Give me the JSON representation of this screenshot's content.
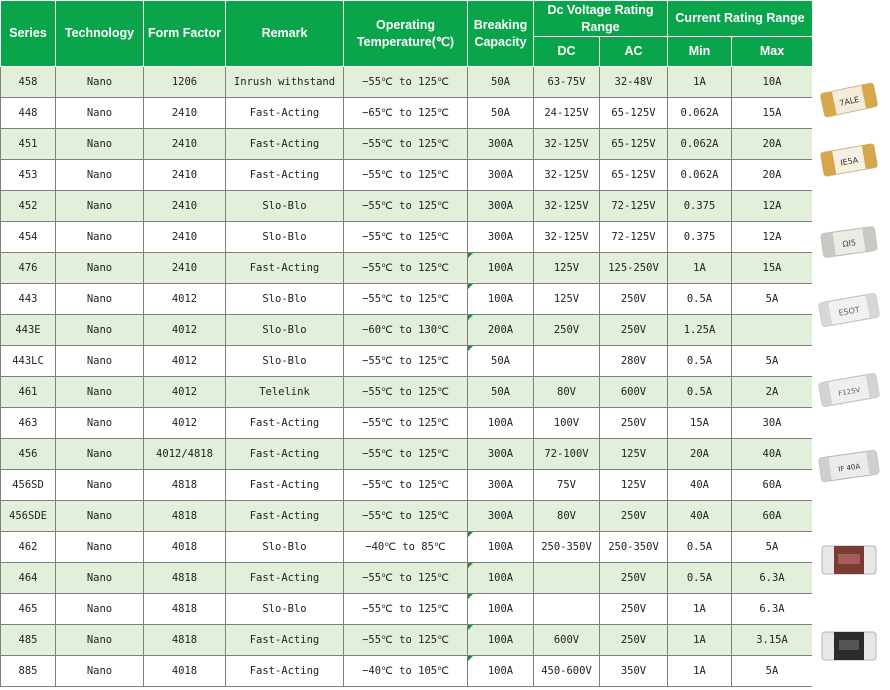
{
  "headers": {
    "series": "Series",
    "technology": "Technology",
    "form_factor": "Form Factor",
    "remark": "Remark",
    "operating_temp": "Operating Temperature(℃)",
    "breaking_capacity": "Breaking Capacity",
    "dc_voltage_range": "Dc Voltage Rating Range",
    "current_range": "Current Rating Range",
    "dc": "DC",
    "ac": "AC",
    "min": "Min",
    "max": "Max"
  },
  "rows": [
    {
      "series": "458",
      "technology": "Nano",
      "form_factor": "1206",
      "remark": "Inrush withstand",
      "temp": "−55℃ to 125℃",
      "breaking": "50A",
      "dc": "63-75V",
      "ac": "32-48V",
      "min": "1A",
      "max": "10A"
    },
    {
      "series": "448",
      "technology": "Nano",
      "form_factor": "2410",
      "remark": "Fast-Acting",
      "temp": "−65℃ to 125℃",
      "breaking": "50A",
      "dc": "24-125V",
      "ac": "65-125V",
      "min": "0.062A",
      "max": "15A"
    },
    {
      "series": "451",
      "technology": "Nano",
      "form_factor": "2410",
      "remark": "Fast-Acting",
      "temp": "−55℃ to 125℃",
      "breaking": "300A",
      "dc": "32-125V",
      "ac": "65-125V",
      "min": "0.062A",
      "max": "20A"
    },
    {
      "series": "453",
      "technology": "Nano",
      "form_factor": "2410",
      "remark": "Fast-Acting",
      "temp": "−55℃ to 125℃",
      "breaking": "300A",
      "dc": "32-125V",
      "ac": "65-125V",
      "min": "0.062A",
      "max": "20A"
    },
    {
      "series": "452",
      "technology": "Nano",
      "form_factor": "2410",
      "remark": "Slo-Blo",
      "temp": "−55℃ to 125℃",
      "breaking": "300A",
      "dc": "32-125V",
      "ac": "72-125V",
      "min": "0.375",
      "max": "12A"
    },
    {
      "series": "454",
      "technology": "Nano",
      "form_factor": "2410",
      "remark": "Slo-Blo",
      "temp": "−55℃ to 125℃",
      "breaking": "300A",
      "dc": "32-125V",
      "ac": "72-125V",
      "min": "0.375",
      "max": "12A"
    },
    {
      "series": "476",
      "technology": "Nano",
      "form_factor": "2410",
      "remark": "Fast-Acting",
      "temp": "−55℃ to 125℃",
      "breaking": "100A",
      "dc": "125V",
      "ac": "125-250V",
      "min": "1A",
      "max": "15A"
    },
    {
      "series": "443",
      "technology": "Nano",
      "form_factor": "4012",
      "remark": "Slo-Blo",
      "temp": "−55℃ to 125℃",
      "breaking": "100A",
      "dc": "125V",
      "ac": "250V",
      "min": "0.5A",
      "max": "5A"
    },
    {
      "series": "443E",
      "technology": "Nano",
      "form_factor": "4012",
      "remark": "Slo-Blo",
      "temp": "−60℃ to 130℃",
      "breaking": "200A",
      "dc": "250V",
      "ac": "250V",
      "min": "1.25A",
      "max": ""
    },
    {
      "series": "443LC",
      "technology": "Nano",
      "form_factor": "4012",
      "remark": "Slo-Blo",
      "temp": "−55℃ to 125℃",
      "breaking": "50A",
      "dc": "",
      "ac": "280V",
      "min": "0.5A",
      "max": "5A"
    },
    {
      "series": "461",
      "technology": "Nano",
      "form_factor": "4012",
      "remark": "Telelink",
      "temp": "−55℃ to 125℃",
      "breaking": "50A",
      "dc": "80V",
      "ac": "600V",
      "min": "0.5A",
      "max": "2A"
    },
    {
      "series": "463",
      "technology": "Nano",
      "form_factor": "4012",
      "remark": "Fast-Acting",
      "temp": "−55℃ to 125℃",
      "breaking": "100A",
      "dc": "100V",
      "ac": "250V",
      "min": "15A",
      "max": "30A"
    },
    {
      "series": "456",
      "technology": "Nano",
      "form_factor": "4012/4818",
      "remark": "Fast-Acting",
      "temp": "−55℃ to 125℃",
      "breaking": "300A",
      "dc": "72-100V",
      "ac": "125V",
      "min": "20A",
      "max": "40A"
    },
    {
      "series": "456SD",
      "technology": "Nano",
      "form_factor": "4818",
      "remark": "Fast-Acting",
      "temp": "−55℃ to 125℃",
      "breaking": "300A",
      "dc": "75V",
      "ac": "125V",
      "min": "40A",
      "max": "60A"
    },
    {
      "series": "456SDE",
      "technology": "Nano",
      "form_factor": "4818",
      "remark": "Fast-Acting",
      "temp": "−55℃ to 125℃",
      "breaking": "300A",
      "dc": "80V",
      "ac": "250V",
      "min": "40A",
      "max": "60A"
    },
    {
      "series": "462",
      "technology": "Nano",
      "form_factor": "4018",
      "remark": "Slo-Blo",
      "temp": "−40℃ to 85℃",
      "breaking": "100A",
      "dc": "250-350V",
      "ac": "250-350V",
      "min": "0.5A",
      "max": "5A"
    },
    {
      "series": "464",
      "technology": "Nano",
      "form_factor": "4818",
      "remark": "Fast-Acting",
      "temp": "−55℃ to 125℃",
      "breaking": "100A",
      "dc": "",
      "ac": "250V",
      "min": "0.5A",
      "max": "6.3A"
    },
    {
      "series": "465",
      "technology": "Nano",
      "form_factor": "4818",
      "remark": "Slo-Blo",
      "temp": "−55℃ to 125℃",
      "breaking": "100A",
      "dc": "",
      "ac": "250V",
      "min": "1A",
      "max": "6.3A"
    },
    {
      "series": "485",
      "technology": "Nano",
      "form_factor": "4818",
      "remark": "Fast-Acting",
      "temp": "−55℃ to 125℃",
      "breaking": "100A",
      "dc": "600V",
      "ac": "250V",
      "min": "1A",
      "max": "3.15A"
    },
    {
      "series": "885",
      "technology": "Nano",
      "form_factor": "4018",
      "remark": "Fast-Acting",
      "temp": "−40℃ to 105℃",
      "breaking": "100A",
      "dc": "450-600V",
      "ac": "350V",
      "min": "1A",
      "max": "5A"
    }
  ],
  "fuse_labels": {
    "f458": "7ALE",
    "f451": "IE5A",
    "f454": "ΩI5",
    "f443": "ESOT",
    "f461": "F125V",
    "f456": "IF 40A"
  },
  "colors": {
    "header_green": "#0aa44b",
    "row_green": "#e2efda",
    "corner_marker": "#1f8f3a"
  }
}
